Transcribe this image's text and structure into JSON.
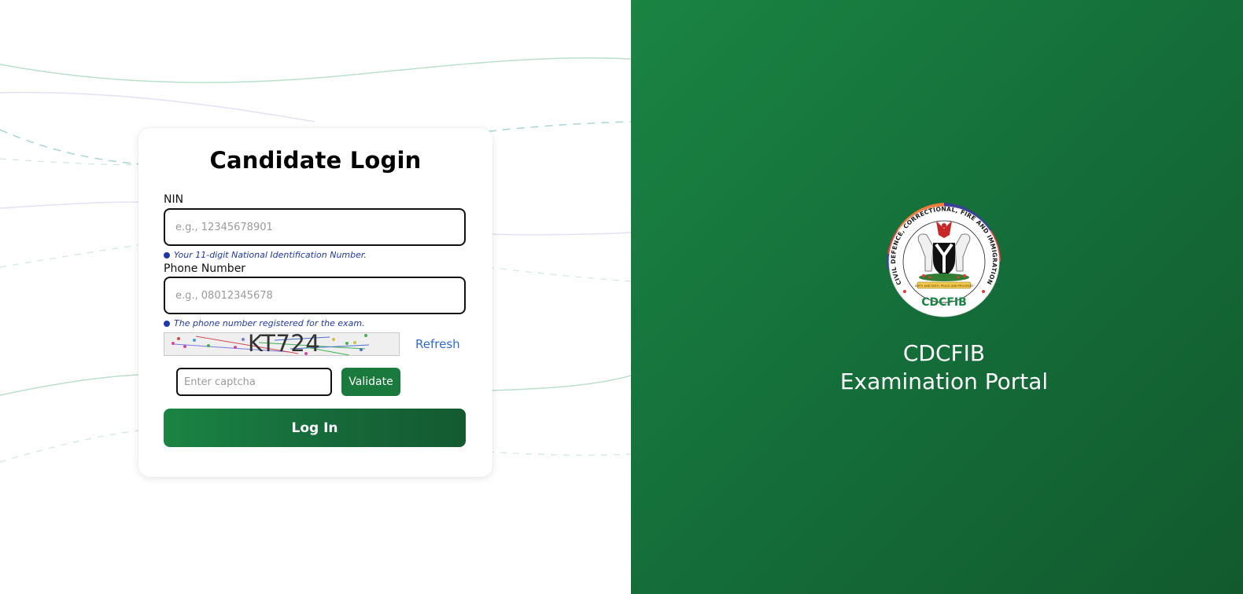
{
  "login": {
    "title": "Candidate Login",
    "nin_label": "NIN",
    "nin_placeholder": "e.g., 12345678901",
    "nin_hint": "Your 11-digit National Identification Number.",
    "phone_label": "Phone Number",
    "phone_placeholder": "e.g., 08012345678",
    "phone_hint": "The phone number registered for the exam.",
    "captcha_text": "KT724",
    "refresh_label": "Refresh",
    "captcha_placeholder": "Enter captcha",
    "validate_label": "Validate",
    "login_label": "Log In"
  },
  "brand": {
    "logo_text": "CDCFIB",
    "seal_ring_text": "CIVIL DEFENCE, CORRECTIONAL, FIRE AND IMMIGRATION SERVICES BOARD",
    "seal_motto": "UNITY AND FAITH, PEACE AND PROGRESS",
    "portal_line1": "CDCFIB",
    "portal_line2": "Examination Portal"
  },
  "colors": {
    "brand_green": "#1a7a3d",
    "hint_blue": "#1f3aa8",
    "link_blue": "#2f6bd6"
  }
}
